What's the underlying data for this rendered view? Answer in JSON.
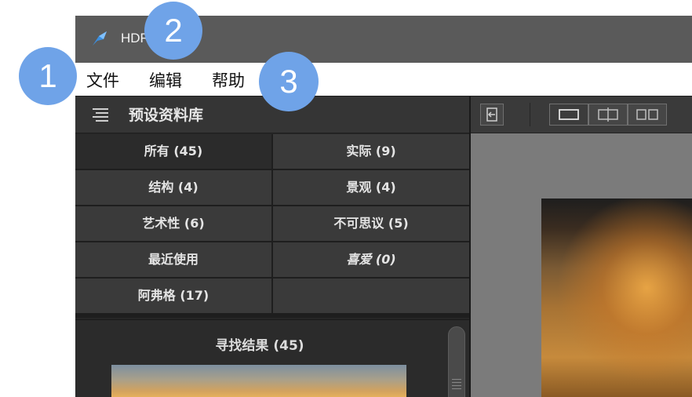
{
  "window": {
    "app_title": "HDR Pro 2",
    "menu": [
      "文件",
      "编辑",
      "帮助"
    ]
  },
  "badges": [
    "1",
    "2",
    "3"
  ],
  "presets_panel": {
    "title": "预设资料库",
    "categories": [
      "所有 (45)",
      "实际 (9)",
      "结构 (4)",
      "景观 (4)",
      "艺术性 (6)",
      "不可思议 (5)",
      "最近使用",
      "喜爱 (0)",
      "阿弗格 (17)",
      ""
    ],
    "selected_category": "所有 (45)",
    "results_title": "寻找结果 (45)"
  },
  "viewer_toolbar": {
    "buttons": [
      "back-icon",
      "single-view-icon",
      "split-view-icon",
      "side-by-side-icon"
    ]
  },
  "colors": {
    "badge": "#6fa3e8",
    "titlebar": "#5a5a5a",
    "panel_bg": "#2b2b2b"
  }
}
